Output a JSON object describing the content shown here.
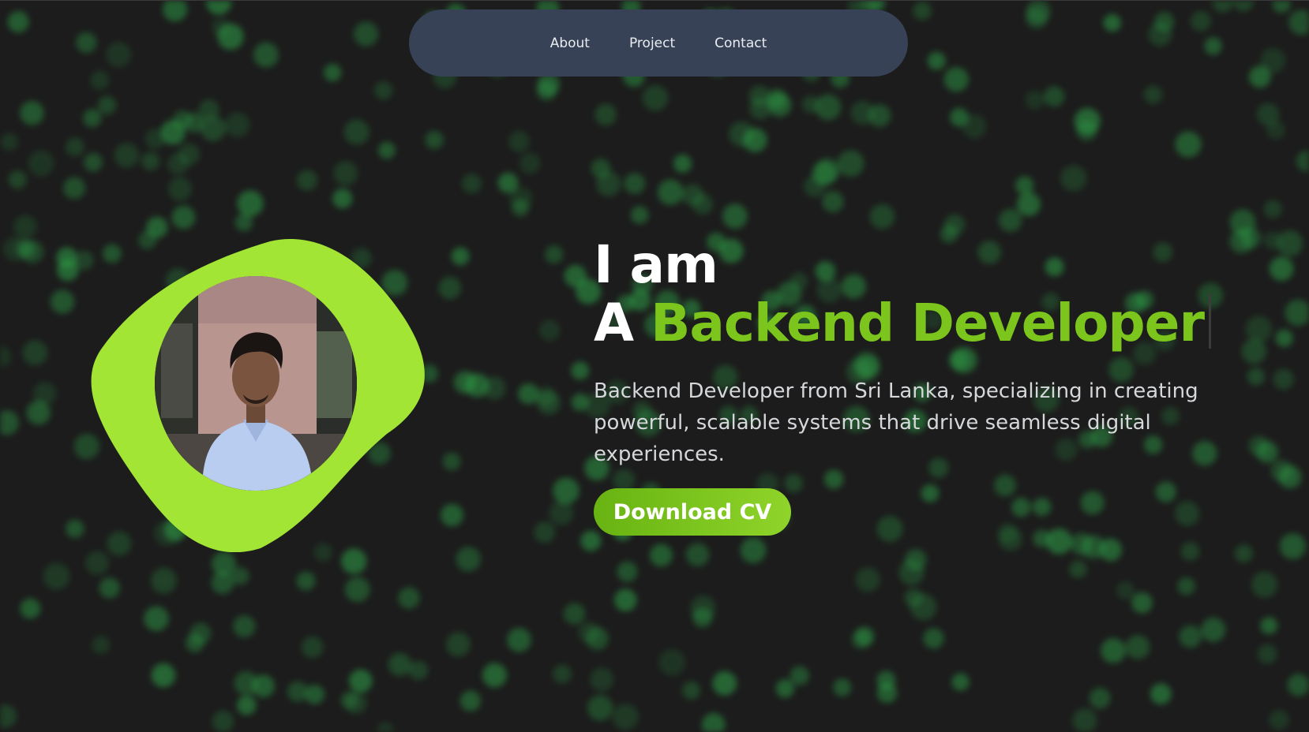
{
  "nav": {
    "items": [
      {
        "label": "About"
      },
      {
        "label": "Project"
      },
      {
        "label": "Contact"
      }
    ]
  },
  "hero": {
    "line1": "I am",
    "prefix": "A",
    "role": "Backend Developer",
    "description": "Backend Developer from Sri Lanka, specializing in creating powerful, scalable systems that drive seamless digital experiences.",
    "cta_label": "Download CV"
  },
  "colors": {
    "background": "#1c1c1c",
    "nav_background": "#374256",
    "accent_green": "#7cc51c",
    "blob_green": "#a2e534",
    "dot_green": "#2fa64a"
  },
  "icons": {
    "avatar": "profile-photo"
  }
}
